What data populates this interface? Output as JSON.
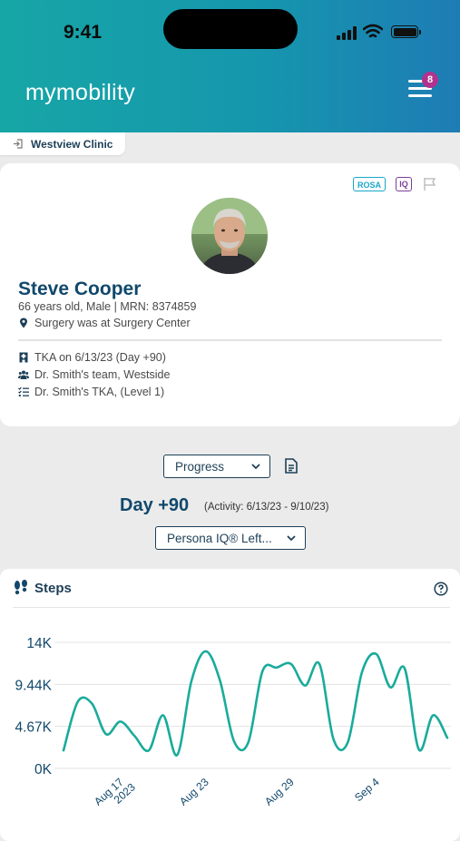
{
  "status_bar": {
    "time": "9:41"
  },
  "header": {
    "logo": "mymobility",
    "notification_count": "8"
  },
  "clinic": {
    "name": "Westview Clinic"
  },
  "tags": {
    "rosa": "ROSA",
    "iq": "IQ"
  },
  "patient": {
    "name": "Steve Cooper",
    "demographics": "66 years old, Male | MRN: 8374859",
    "surgery_location": "Surgery was at Surgery Center",
    "procedure": "TKA on 6/13/23 (Day +90)",
    "team": "Dr. Smith's team, Westside",
    "protocol": "Dr. Smith's TKA, (Level 1)"
  },
  "controls": {
    "view_select": "Progress",
    "day": "Day +90",
    "activity_range": "(Activity: 6/13/23 - 9/10/23)",
    "device_select": "Persona IQ® Left..."
  },
  "chart_card": {
    "title": "Steps"
  },
  "colors": {
    "line": "#1aab9b",
    "title": "#11486b"
  },
  "chart_data": {
    "type": "line",
    "title": "Steps",
    "y_ticks": [
      "14K",
      "9.44K",
      "4.67K",
      "0K"
    ],
    "ylim": [
      0,
      14000
    ],
    "x_ticks": [
      {
        "label": "Aug 17",
        "sublabel": "2023",
        "day": 4
      },
      {
        "label": "Aug 23",
        "sublabel": "",
        "day": 10
      },
      {
        "label": "Aug 29",
        "sublabel": "",
        "day": 16
      },
      {
        "label": "Sep 4",
        "sublabel": "",
        "day": 22
      }
    ],
    "series": [
      {
        "values": [
          2000,
          7400,
          7200,
          3800,
          5200,
          3600,
          2000,
          5900,
          1500,
          9700,
          13000,
          9800,
          3000,
          2900,
          10800,
          11200,
          11600,
          9200,
          11600,
          3200,
          2900,
          10700,
          12700,
          9000,
          11100,
          2100,
          5900,
          3400
        ]
      }
    ]
  }
}
